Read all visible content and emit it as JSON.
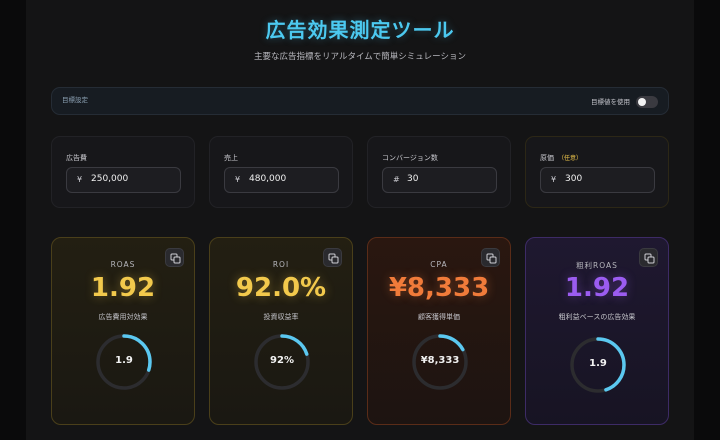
{
  "header": {
    "title": "広告効果測定ツール",
    "subtitle": "主要な広告指標をリアルタイムで簡単シミュレーション"
  },
  "target": {
    "label": "目標設定",
    "toggle_label": "目標値を使用",
    "toggle_on": false
  },
  "inputs": [
    {
      "label": "広告費",
      "unit": "¥",
      "value": "250,000"
    },
    {
      "label": "売上",
      "unit": "¥",
      "value": "480,000"
    },
    {
      "label": "コンバージョン数",
      "unit": "#",
      "value": "30"
    },
    {
      "label": "原価",
      "optional": "（任意）",
      "unit": "¥",
      "value": "300"
    }
  ],
  "metrics": [
    {
      "label": "ROAS",
      "value": "1.92",
      "desc": "広告費用対効果",
      "gauge_text": "1.9",
      "gauge_fraction": 0.3,
      "color": "#f2c94c",
      "ring_color": "#5bc8f0"
    },
    {
      "label": "ROI",
      "value": "92.0%",
      "desc": "投資収益率",
      "gauge_text": "92%",
      "gauge_fraction": 0.2,
      "color": "#f2c94c",
      "ring_color": "#5bc8f0"
    },
    {
      "label": "CPA",
      "value": "¥8,333",
      "desc": "顧客獲得単価",
      "gauge_text": "¥8,333",
      "gauge_fraction": 0.17,
      "color": "#f07b3a",
      "ring_color": "#5bc8f0"
    },
    {
      "label": "粗利ROAS",
      "value": "1.92",
      "desc": "粗利益ベースの広告効果",
      "gauge_text": "1.9",
      "gauge_fraction": 0.45,
      "color": "#9b5cf0",
      "ring_color": "#5bc8f0"
    }
  ],
  "icons": {
    "copy": "copy-icon"
  }
}
